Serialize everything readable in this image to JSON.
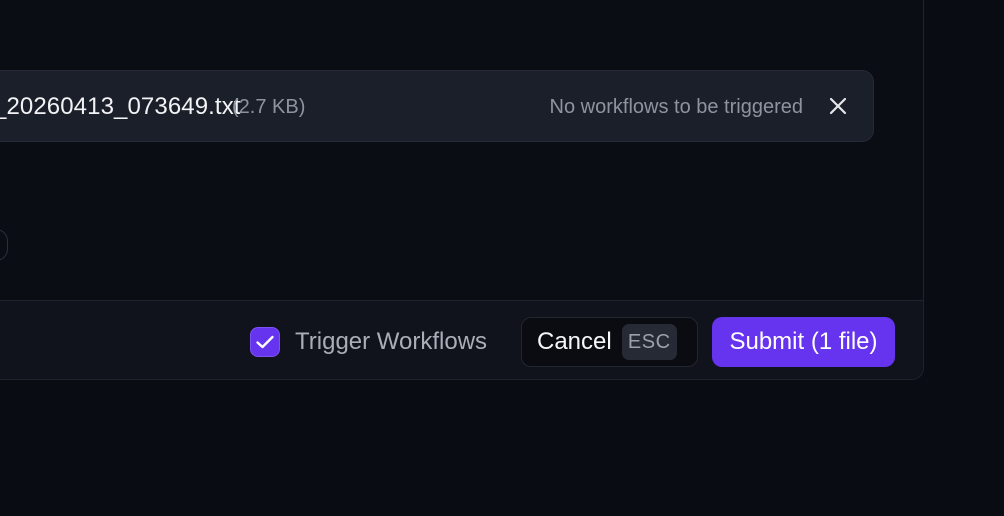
{
  "file": {
    "name": "_20260413_073649.txt",
    "size": "(2.7 KB)",
    "status": "No workflows to be triggered",
    "remove_icon": "close-icon"
  },
  "footer": {
    "trigger_checked": true,
    "trigger_label": "Trigger Workflows",
    "check_icon": "check-icon",
    "cancel_label": "Cancel",
    "cancel_shortcut": "ESC",
    "submit_label": "Submit (1 file)"
  },
  "colors": {
    "accent": "#6633ee",
    "background": "#0a0c14",
    "card": "#1b1f29"
  }
}
